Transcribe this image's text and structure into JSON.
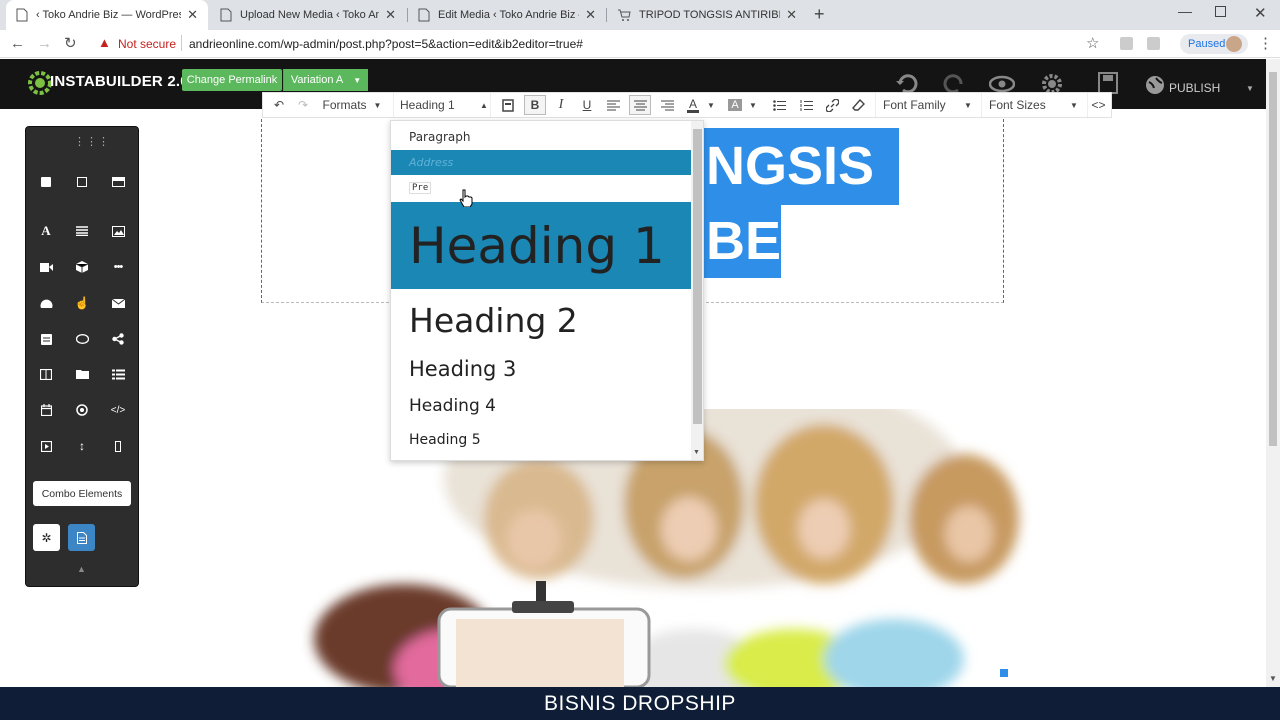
{
  "browser": {
    "tabs": [
      {
        "title": "‹ Toko Andrie Biz — WordPress"
      },
      {
        "title": "Upload New Media ‹ Toko Andrie"
      },
      {
        "title": "Edit Media ‹ Toko Andrie Biz — W"
      },
      {
        "title": "TRIPOD TONGSIS ANTIRIBET - To"
      }
    ],
    "not_secure": "Not secure",
    "url": "andrieonline.com/wp-admin/post.php?post=5&action=edit&ib2editor=true#",
    "profile_status": "Paused"
  },
  "builder": {
    "logo": "INSTABUILDER 2.0",
    "change_permalink": "Change Permalink",
    "variation": "Variation A",
    "publish": "PUBLISH"
  },
  "toolbar": {
    "formats": "Formats",
    "block_format": "Heading 1",
    "font_family": "Font Family",
    "font_sizes": "Font Sizes"
  },
  "format_menu": {
    "items": [
      "Paragraph",
      "Address",
      "Pre",
      "Heading 1",
      "Heading 2",
      "Heading 3",
      "Heading 4",
      "Heading 5"
    ],
    "selected": "Heading 1",
    "hovered": "Address"
  },
  "canvas": {
    "headline_line1": "NGSIS",
    "headline_line2": "BET"
  },
  "panel": {
    "combo_label": "Combo Elements"
  },
  "footer": {
    "caption": "BISNIS DROPSHIP"
  },
  "colors": {
    "accent_blue": "#1b87b5",
    "highlight_blue": "#2f8fe8",
    "green_button": "#5cb85c",
    "footer_bg": "#0f1e36"
  }
}
